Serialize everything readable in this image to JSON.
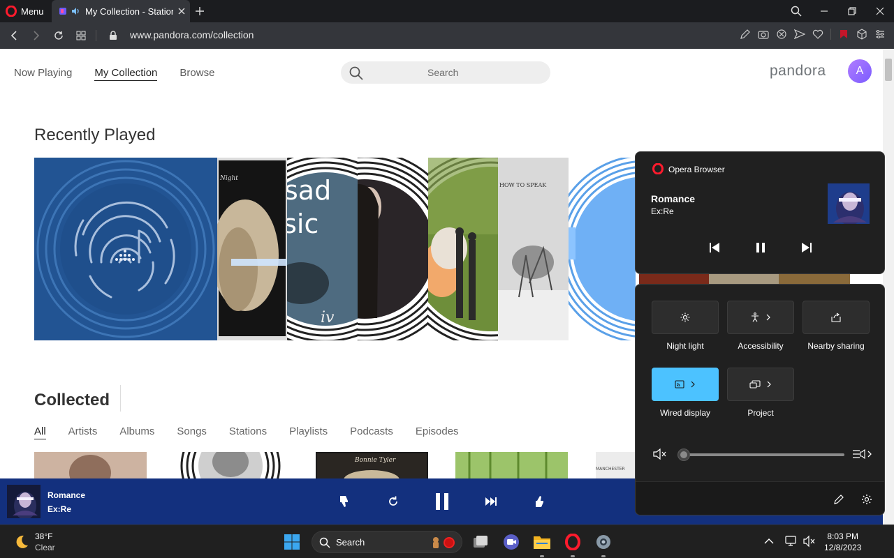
{
  "browser": {
    "menu_label": "Menu",
    "tab_title": "My Collection - Station",
    "url": "www.pandora.com/collection"
  },
  "page": {
    "nav": [
      "Now Playing",
      "My Collection",
      "Browse"
    ],
    "active_nav": "My Collection",
    "search_placeholder": "Search",
    "brand": "pandora",
    "avatar_letter": "A",
    "recently_played_title": "Recently Played",
    "recent_art": [
      {
        "icon": "fingerprint-music-icon"
      },
      {
        "text": "Night"
      },
      {
        "text": "sad\nusic",
        "line1": "sad",
        "line2": "usic",
        "script": "iv"
      },
      {},
      {},
      {
        "text": "HOW TO SPEAK"
      },
      {}
    ],
    "collected_title": "Collected",
    "filters": [
      "All",
      "Artists",
      "Albums",
      "Songs",
      "Stations",
      "Playlists",
      "Podcasts",
      "Episodes"
    ],
    "active_filter": "All",
    "collected_card_text": [
      "",
      "",
      "Bonnie Tyler",
      "",
      "MANCHESTER"
    ]
  },
  "player": {
    "song": "Romance",
    "artist": "Ex:Re",
    "colors": {
      "bar": "#13307e"
    }
  },
  "media_flyout": {
    "app": "Opera Browser",
    "song": "Romance",
    "artist": "Ex:Re"
  },
  "quick_settings": {
    "tiles": [
      {
        "label": "Night light",
        "icon": "brightness-icon",
        "on": false
      },
      {
        "label": "Accessibility",
        "icon": "accessibility-icon",
        "on": false
      },
      {
        "label": "Nearby sharing",
        "icon": "share-icon",
        "on": false
      },
      {
        "label": "Wired display",
        "icon": "cast-icon",
        "on": true
      },
      {
        "label": "Project",
        "icon": "project-icon",
        "on": false
      }
    ],
    "volume": 0,
    "accent": "#4cc2ff"
  },
  "taskbar": {
    "temp": "38°F",
    "condition": "Clear",
    "search_label": "Search",
    "time": "8:03 PM",
    "date": "12/8/2023"
  }
}
